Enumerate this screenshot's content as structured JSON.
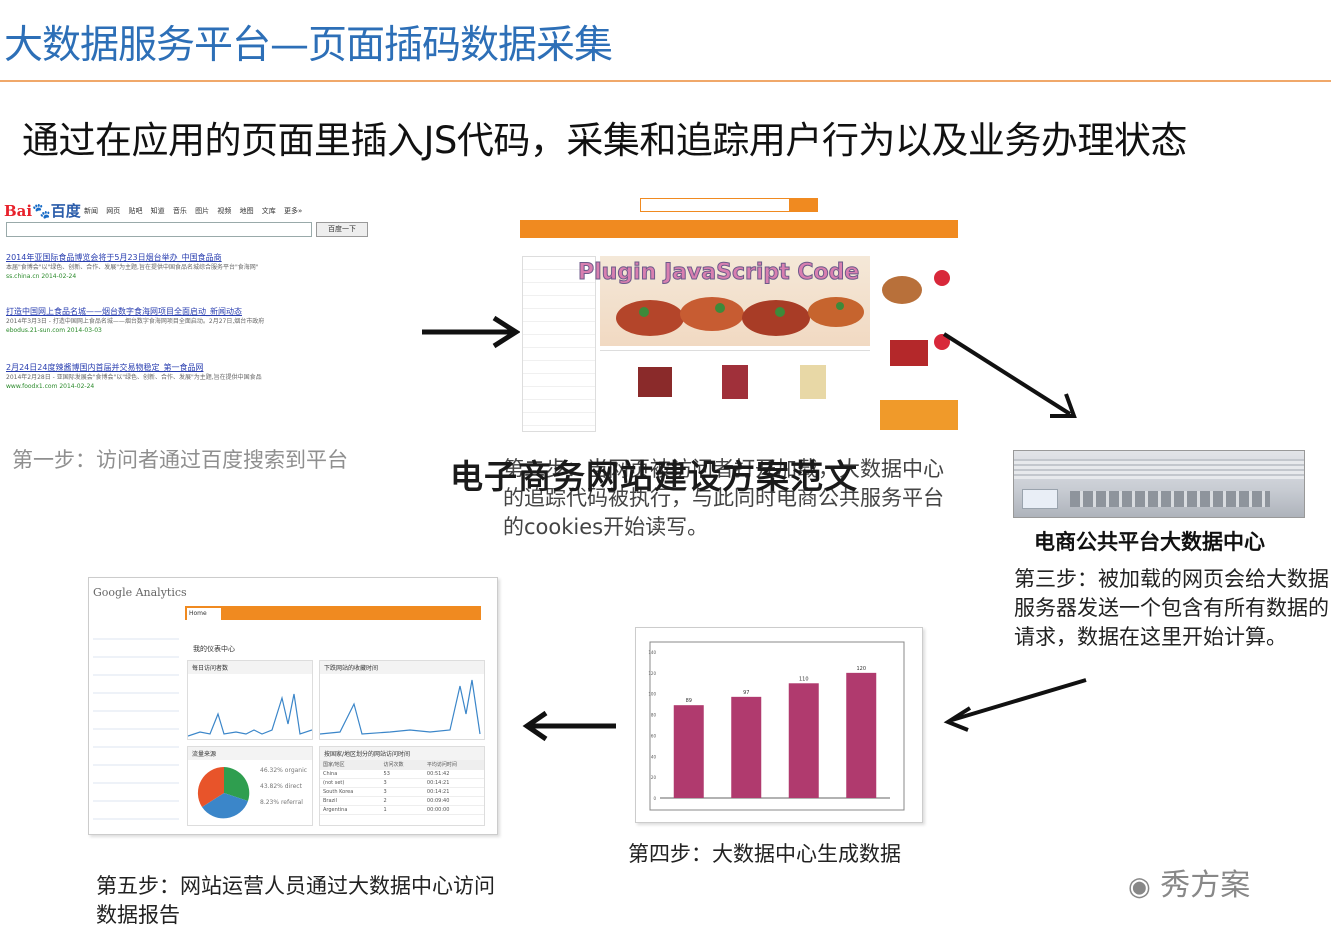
{
  "header": {
    "title": "大数据服务平台—页面插码数据采集",
    "subtitle": "通过在应用的页面里插入JS代码，采集和追踪用户行为以及业务办理状态"
  },
  "baidu": {
    "logo_a": "Bai",
    "logo_b": "百度",
    "nav": "新闻 网页 贴吧 知道 音乐 图片 视频 地图 文库 更多»",
    "button": "百度一下",
    "results": [
      {
        "title": "2014年亚国际食品博览会将于5月23日烟台举办_中国食品商",
        "body": "本届\"食博会\"以\"绿色、创新、合作、发展\"为主题,旨在提供中国食品名城综合服务平台\"食海网\"",
        "url": "ss.china.cn 2014-02-24"
      },
      {
        "title": "打造中国网上食品名城——烟台数字食海网项目全面启动_新闻动态",
        "body": "2014年3月3日 - 打造中国网上食品名城——烟台数字食海网项目全面启动。2月27日,烟台市政府",
        "url": "ebodus.21-sun.com 2014-03-03"
      },
      {
        "title": "2月24日24度辣酱博国内首届并交易物稳定_第一食品网",
        "body": "2014年2月28日 - 亚国际发展会\"食博会\"以\"绿色、创新、合作、发展\"为主题,旨在提供中国食品",
        "url": "www.foodx1.com 2014-02-24"
      }
    ]
  },
  "shop": {
    "plugin_label": "Plugin JavaScript Code"
  },
  "steps": {
    "step1": "第一步：访问者通过百度搜索到平台",
    "step2": "第二步：当网页被访问者打开加载，大数据中心的追踪代码被执行，与此同时电商公共服务平台的cookies开始读写。",
    "step3": "第三步：被加载的网页会给大数据服务器发送一个包含有所有数据的请求，数据在这里开始计算。",
    "step4": "第四步：大数据中心生成数据",
    "step5": "第五步：网站运营人员通过大数据中心访问数据报告"
  },
  "datacenter_label": "电商公共平台大数据中心",
  "overlay_text": "电子商务网站建设方案范文",
  "analytics": {
    "logo": "Google Analytics",
    "home_tab": "Home",
    "my_center": "我的仪表中心",
    "panel1": "每日访问者数",
    "panel2": "下跌网站的收藏时间",
    "panel3": "流量来源",
    "panel4": "按国家/地区划分的网站访问时间",
    "legend": [
      {
        "pct": "46.32% organic",
        "color": "#2f9e4f"
      },
      {
        "pct": "43.82% direct",
        "color": "#3b86c9"
      },
      {
        "pct": "8.23% referral",
        "color": "#e8542a"
      }
    ],
    "table_head": [
      "国家/地区",
      "访问次数",
      "平均访问时间"
    ],
    "table_rows": [
      [
        "China",
        "53",
        "00:51:42"
      ],
      [
        "(not set)",
        "3",
        "00:14:21"
      ],
      [
        "South Korea",
        "3",
        "00:14:21"
      ],
      [
        "Brazil",
        "2",
        "00:09:40"
      ],
      [
        "Argentina",
        "1",
        "00:00:00"
      ]
    ],
    "colors": {
      "orange": "#f08a20",
      "pie_green": "#2f9e4f",
      "pie_blue": "#3b86c9",
      "pie_orange": "#e8542a"
    }
  },
  "chart_data": {
    "type": "bar",
    "title": "",
    "categories": [
      "",
      "",
      "",
      ""
    ],
    "values": [
      89,
      97,
      110,
      120
    ],
    "ylim": [
      0,
      140
    ],
    "yticks": [
      0,
      20,
      40,
      60,
      80,
      100,
      120,
      140
    ],
    "bar_color": "#b03a6e"
  },
  "watermark": "秀方案"
}
